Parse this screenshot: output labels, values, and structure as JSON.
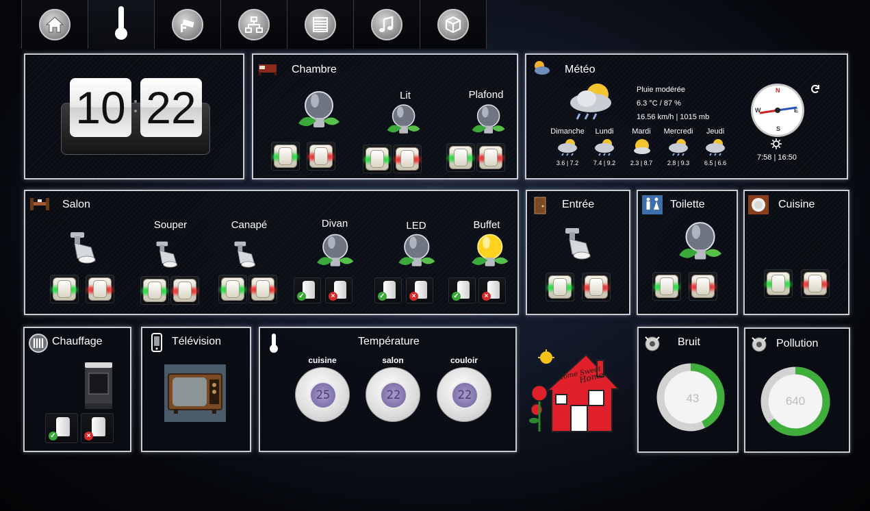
{
  "nav": {
    "items": [
      "home-icon",
      "thermometer-icon",
      "camera-icon",
      "network-icon",
      "blinds-icon",
      "music-icon",
      "cube-icon"
    ]
  },
  "clock": {
    "hours": "10",
    "minutes": "22"
  },
  "chambre": {
    "title": "Chambre",
    "lamps": [
      {
        "label": ""
      },
      {
        "label": "Lit"
      },
      {
        "label": "Plafond"
      }
    ]
  },
  "meteo": {
    "title": "Météo",
    "condition": "Pluie modérée",
    "temp_humidity": "6.3 °C / 87 %",
    "wind_pressure": "16.56 km/h | 1015 mb",
    "sun": "7:58 | 16:50",
    "compass": {
      "n": "N",
      "s": "S",
      "e": "E",
      "w": "W"
    },
    "forecast": [
      {
        "day": "Dimanche",
        "temps": "3.6 | 7.2"
      },
      {
        "day": "Lundi",
        "temps": "7.4 | 9.2"
      },
      {
        "day": "Mardi",
        "temps": "2.3 | 8.7"
      },
      {
        "day": "Mercredi",
        "temps": "2.8 | 9.3"
      },
      {
        "day": "Jeudi",
        "temps": "6.5 | 6.6"
      }
    ]
  },
  "salon": {
    "title": "Salon",
    "lamps": [
      {
        "label": ""
      },
      {
        "label": "Souper"
      },
      {
        "label": "Canapé"
      },
      {
        "label": "Divan"
      },
      {
        "label": "LED"
      },
      {
        "label": "Buffet"
      }
    ]
  },
  "entree": {
    "title": "Entrée"
  },
  "toilette": {
    "title": "Toilette"
  },
  "cuisine": {
    "title": "Cuisine"
  },
  "chauffage": {
    "title": "Chauffage"
  },
  "television": {
    "title": "Télévision"
  },
  "temperature": {
    "title": "Température",
    "zones": [
      {
        "label": "cuisine",
        "value": "25"
      },
      {
        "label": "salon",
        "value": "22"
      },
      {
        "label": "couloir",
        "value": "22"
      }
    ]
  },
  "logo": {
    "text1": "Home Sweet",
    "text2": "Home"
  },
  "bruit": {
    "title": "Bruit",
    "value": "43",
    "fraction": 0.43
  },
  "pollution": {
    "title": "Pollution",
    "value": "640",
    "fraction": 0.64
  },
  "colors": {
    "accent_green": "#3fae3a",
    "panel_border": "#c9ced6"
  }
}
